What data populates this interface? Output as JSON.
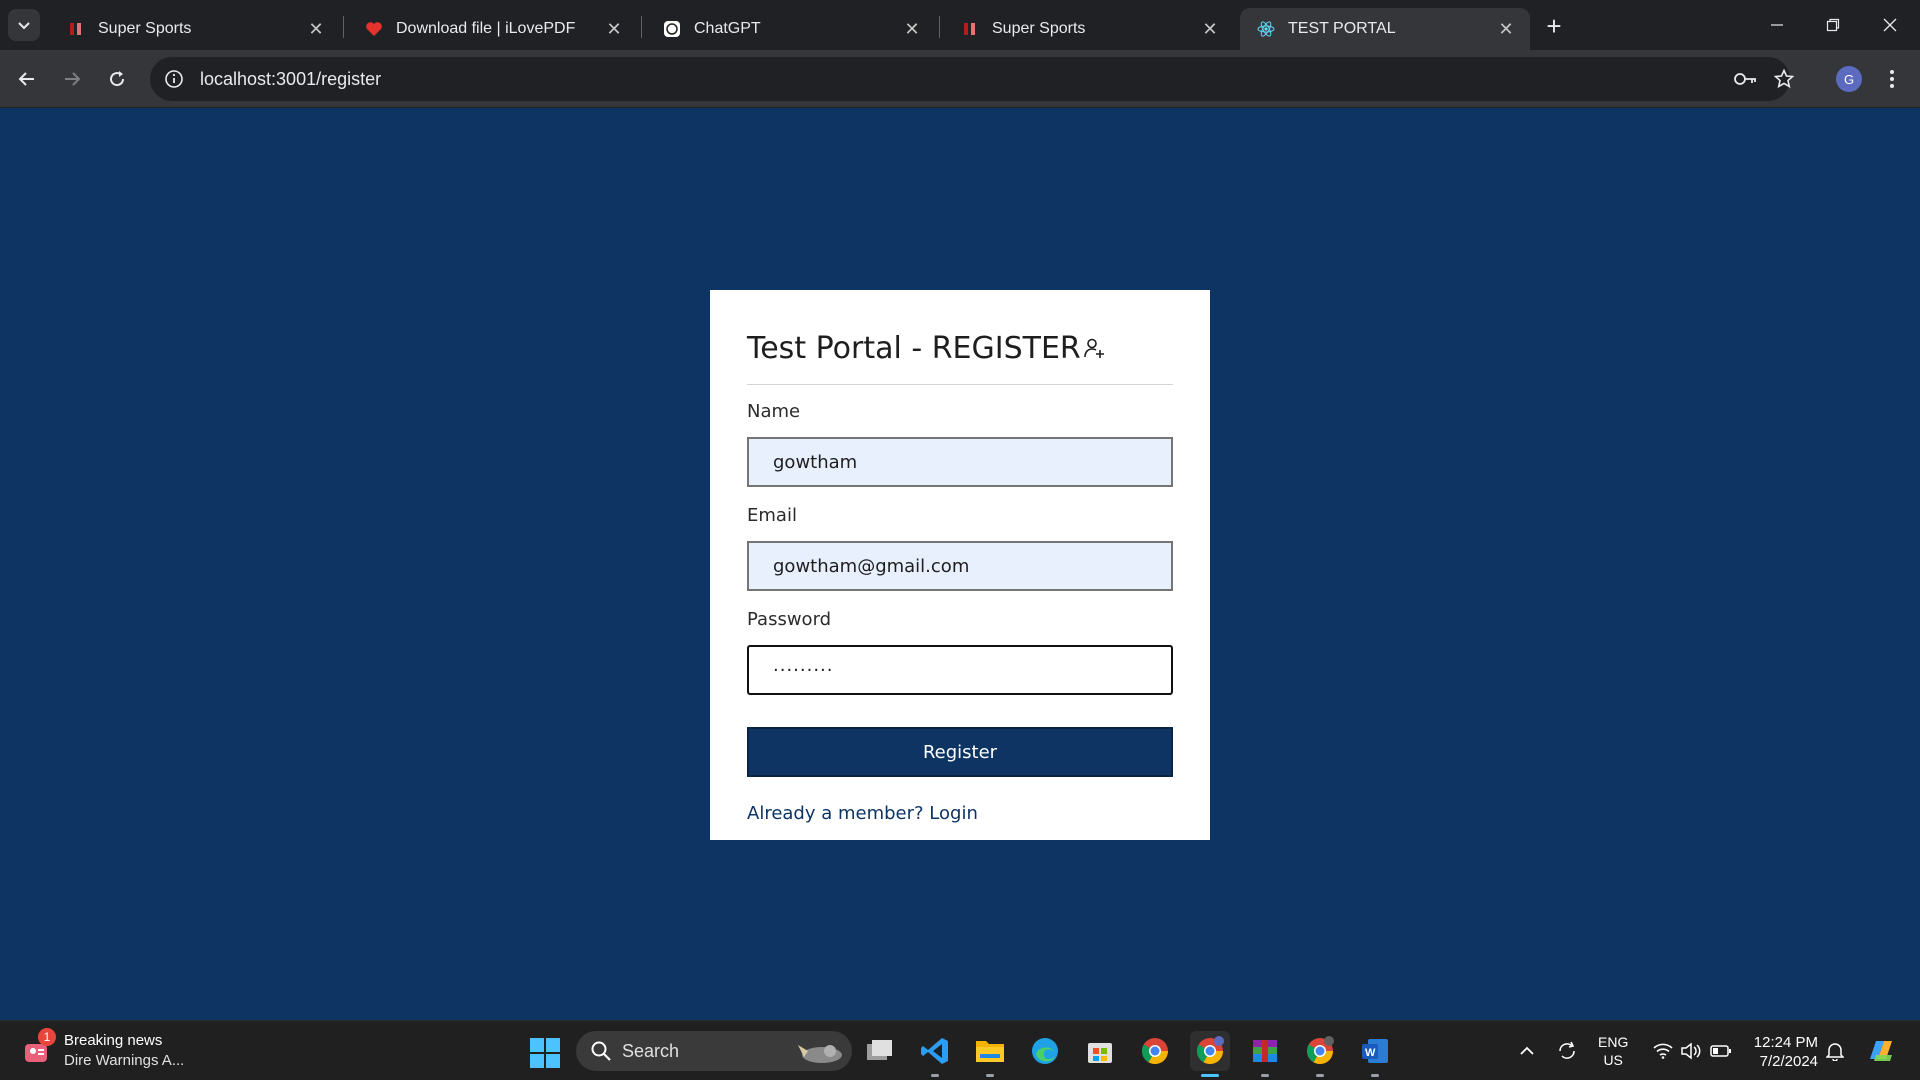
{
  "browser": {
    "tabs": [
      {
        "title": "Super Sports",
        "active": false
      },
      {
        "title": "Download file | iLovePDF",
        "active": false
      },
      {
        "title": "ChatGPT",
        "active": false
      },
      {
        "title": "Super Sports",
        "active": false
      },
      {
        "title": "TEST PORTAL",
        "active": true
      }
    ],
    "url": "localhost:3001/register",
    "profile_initial": "G"
  },
  "form": {
    "title": "Test Portal - REGISTER",
    "name_label": "Name",
    "name_value": "gowtham",
    "email_label": "Email",
    "email_value": "gowtham@gmail.com",
    "password_label": "Password",
    "password_value": "·········",
    "register_label": "Register",
    "login_text": "Already a member? Login"
  },
  "colors": {
    "page_background": "#0e3463",
    "button_background": "#0e3463",
    "autofill_background": "#e8f0fe"
  },
  "taskbar": {
    "news_title": "Breaking news",
    "news_subtitle": "Dire Warnings A...",
    "news_badge": "1",
    "search_placeholder": "Search",
    "lang_top": "ENG",
    "lang_bottom": "US",
    "time": "12:24 PM",
    "date": "7/2/2024"
  }
}
